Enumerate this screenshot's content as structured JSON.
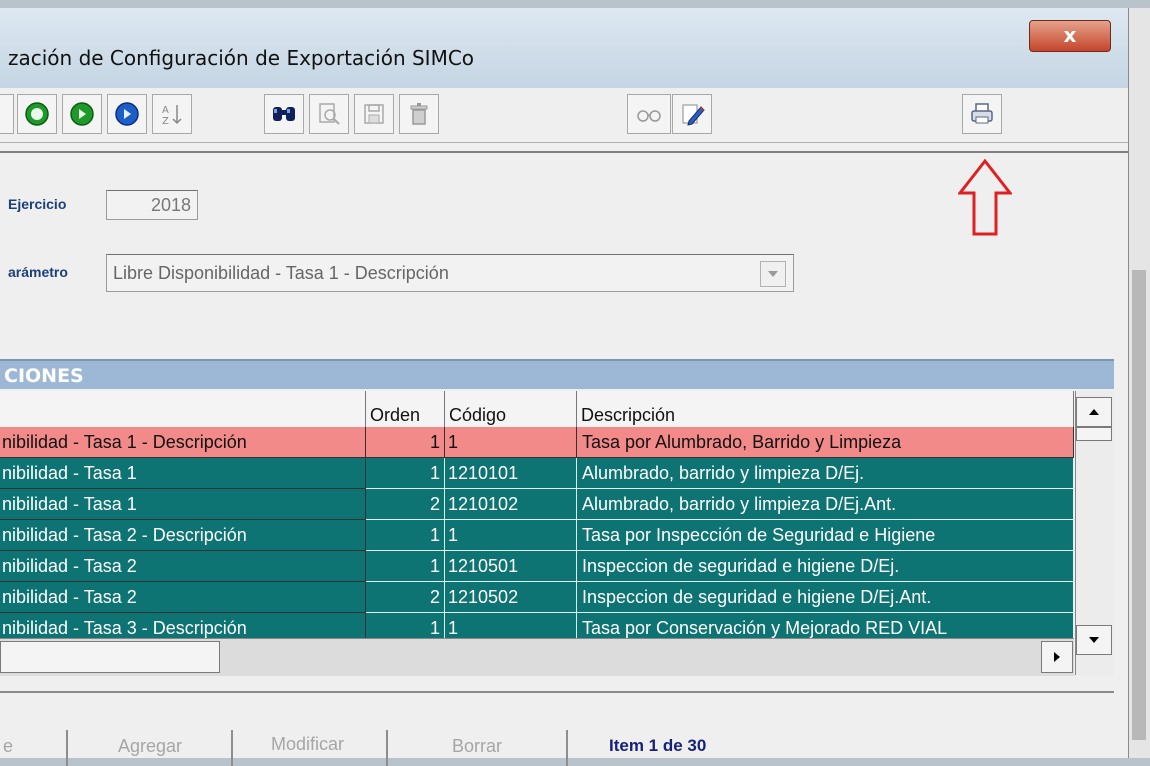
{
  "window": {
    "title": "zación de Configuración de Exportación SIMCo",
    "close_label": "x"
  },
  "toolbar": {
    "buttons": [
      {
        "icon": "first-record-icon"
      },
      {
        "icon": "previous-record-icon"
      },
      {
        "icon": "next-record-icon"
      },
      {
        "icon": "sort-az-icon"
      },
      {
        "icon": "binoculars-icon"
      },
      {
        "icon": "preview-icon"
      },
      {
        "icon": "save-icon"
      },
      {
        "icon": "trash-icon"
      },
      {
        "icon": "glasses-icon"
      },
      {
        "icon": "edit-icon"
      },
      {
        "icon": "print-icon"
      }
    ]
  },
  "form": {
    "ejercicio_label": "Ejercicio",
    "ejercicio_value": "2018",
    "parametro_label": "arámetro",
    "parametro_value": "Libre Disponibilidad - Tasa 1 - Descripción"
  },
  "section_title": "CIONES",
  "grid": {
    "columns": [
      "Orden",
      "Código",
      "Descripción"
    ],
    "rows": [
      {
        "name": "nibilidad - Tasa 1 - Descripción",
        "orden": "1",
        "codigo": "1",
        "descripcion": "Tasa por Alumbrado, Barrido y Limpieza",
        "style": "red"
      },
      {
        "name": "nibilidad - Tasa 1",
        "orden": "1",
        "codigo": "1210101",
        "descripcion": "Alumbrado, barrido y limpieza D/Ej.",
        "style": "teal"
      },
      {
        "name": "nibilidad - Tasa 1",
        "orden": "2",
        "codigo": "1210102",
        "descripcion": "Alumbrado, barrido y limpieza D/Ej.Ant.",
        "style": "teal"
      },
      {
        "name": "nibilidad - Tasa 2 - Descripción",
        "orden": "1",
        "codigo": "1",
        "descripcion": "Tasa por Inspección de Seguridad e Higiene",
        "style": "teal"
      },
      {
        "name": "nibilidad - Tasa 2",
        "orden": "1",
        "codigo": "1210501",
        "descripcion": "Inspeccion de seguridad e higiene D/Ej.",
        "style": "teal"
      },
      {
        "name": "nibilidad - Tasa 2",
        "orden": "2",
        "codigo": "1210502",
        "descripcion": "Inspeccion de seguridad e higiene D/Ej.Ant.",
        "style": "teal"
      },
      {
        "name": "nibilidad - Tasa 3 - Descripción",
        "orden": "1",
        "codigo": "1",
        "descripcion": "Tasa por Conservación y Mejorado RED VIAL",
        "style": "teal"
      }
    ]
  },
  "bottom": {
    "btn_partial": "e",
    "agregar": "Agregar",
    "modificar": "Modificar",
    "borrar": "Borrar",
    "item_status": "Item 1 de 30"
  },
  "colors": {
    "selected_row": "#f28a8a",
    "row": "#0d7373",
    "section_bar": "#9cb8d6",
    "annotation_arrow": "#e02020"
  }
}
